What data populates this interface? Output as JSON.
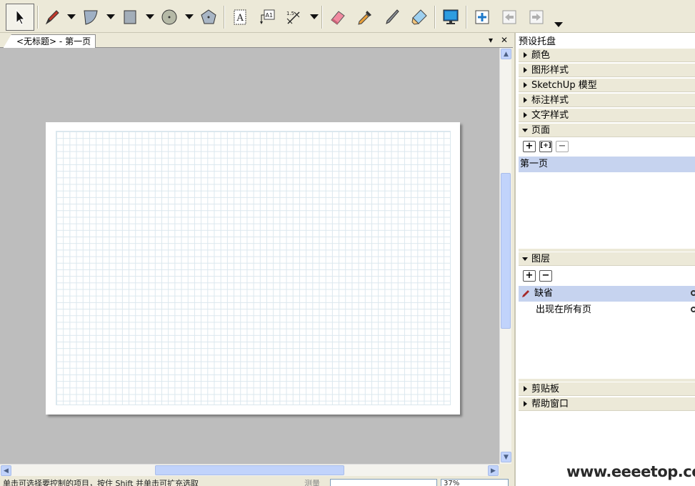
{
  "toolbar": {
    "tools": [
      {
        "id": "select",
        "icon": "cursor-arrow-icon"
      },
      {
        "id": "pencil",
        "icon": "pencil-icon"
      },
      {
        "id": "arc",
        "icon": "arc-icon"
      },
      {
        "id": "rectangle",
        "icon": "rectangle-icon"
      },
      {
        "id": "circle",
        "icon": "circle-icon"
      },
      {
        "id": "polygon",
        "icon": "polygon-icon"
      },
      {
        "id": "text",
        "icon": "text-icon"
      },
      {
        "id": "label",
        "icon": "label-icon"
      },
      {
        "id": "dimension",
        "icon": "dimension-icon"
      },
      {
        "id": "eraser",
        "icon": "eraser-icon"
      },
      {
        "id": "eyedropper",
        "icon": "eyedropper-icon"
      },
      {
        "id": "split",
        "icon": "split-icon"
      },
      {
        "id": "join",
        "icon": "join-icon"
      },
      {
        "id": "presentation",
        "icon": "monitor-icon"
      },
      {
        "id": "add-page",
        "icon": "add-page-icon"
      },
      {
        "id": "prev-page",
        "icon": "previous-page-icon"
      },
      {
        "id": "next-page",
        "icon": "next-page-icon"
      }
    ]
  },
  "document": {
    "tab_label": "<无标题> - 第一页",
    "close_glyph": "✕",
    "menu_glyph": "▾"
  },
  "status": {
    "hint": "单击可选择要控制的项目，按住 Shift 并单击可扩充选取",
    "measure_label": "测量",
    "zoom": "37%"
  },
  "tray": {
    "title": "预设托盘",
    "panels": [
      {
        "label": "颜色",
        "expanded": false
      },
      {
        "label": "图形样式",
        "expanded": false
      },
      {
        "label": "SketchUp 模型",
        "expanded": false
      },
      {
        "label": "标注样式",
        "expanded": false
      },
      {
        "label": "文字样式",
        "expanded": false
      },
      {
        "label": "页面",
        "expanded": true
      },
      {
        "label": "图层",
        "expanded": true
      },
      {
        "label": "剪贴板",
        "expanded": false
      },
      {
        "label": "帮助窗口",
        "expanded": false
      }
    ],
    "pages": [
      "第一页"
    ],
    "layers": [
      {
        "name": "缺省",
        "active": true
      },
      {
        "name": "出现在所有页",
        "active": false
      }
    ]
  },
  "watermark": "www.eeeetop.com"
}
